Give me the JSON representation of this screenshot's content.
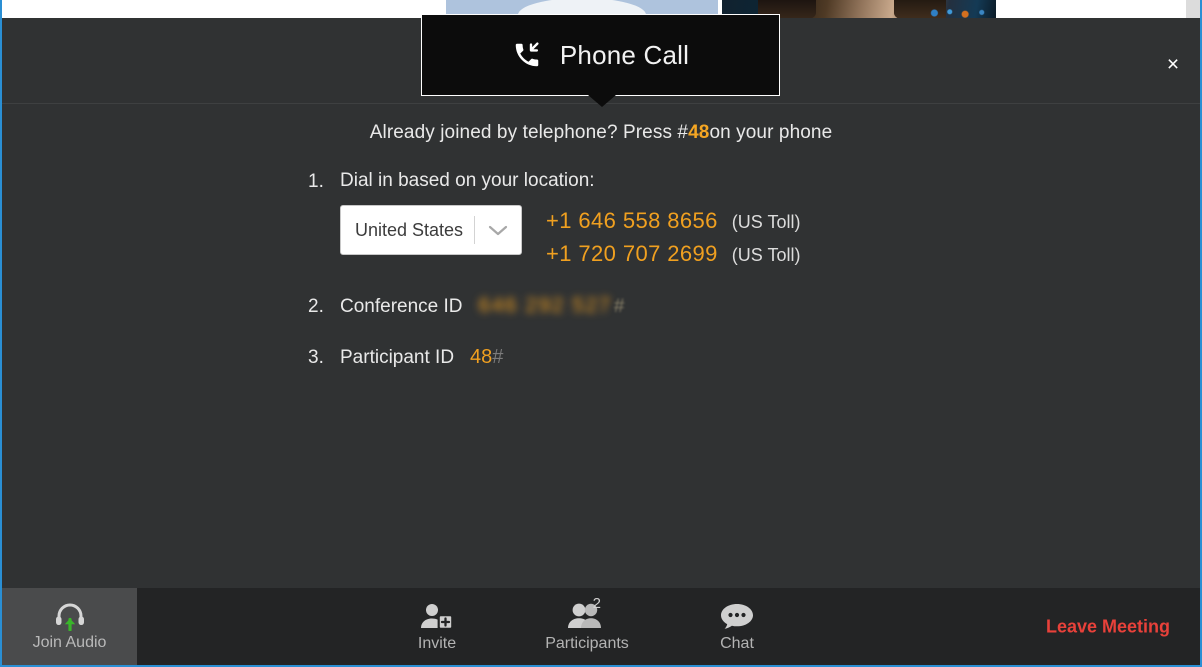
{
  "window": {
    "accent_border_color": "#2a8fd4",
    "dialog_bg": "#303233",
    "toolbar_bg": "#232425",
    "orange": "#f0a020",
    "leave_red": "#e8413a"
  },
  "call_tab": {
    "title": "Phone Call",
    "icon": "phone-incoming-icon"
  },
  "dialog": {
    "close_label": "×",
    "banner": {
      "prefix": "Already joined by telephone? Press #",
      "code": "48",
      "suffix": "on your phone"
    },
    "steps": {
      "dial": {
        "num": "1.",
        "label": "Dial in based on your location:",
        "country": {
          "selected": "United States",
          "chevron": "chevron-down-icon"
        },
        "numbers": [
          {
            "number": "+1 646 558 8656",
            "note": "(US Toll)"
          },
          {
            "number": "+1 720 707 2699",
            "note": "(US Toll)"
          }
        ]
      },
      "conference": {
        "num": "2.",
        "label": "Conference ID",
        "value": "646 292 527",
        "hash": "#"
      },
      "participant": {
        "num": "3.",
        "label": "Participant ID",
        "value": "48",
        "hash": "#"
      }
    }
  },
  "toolbar": {
    "join_audio": {
      "label": "Join Audio",
      "icon": "headset-join-icon"
    },
    "items": [
      {
        "label": "Invite",
        "icon": "person-add-icon",
        "badge": ""
      },
      {
        "label": "Participants",
        "icon": "people-icon",
        "badge": "2"
      },
      {
        "label": "Chat",
        "icon": "chat-bubble-icon",
        "badge": ""
      }
    ],
    "leave_label": "Leave Meeting"
  }
}
